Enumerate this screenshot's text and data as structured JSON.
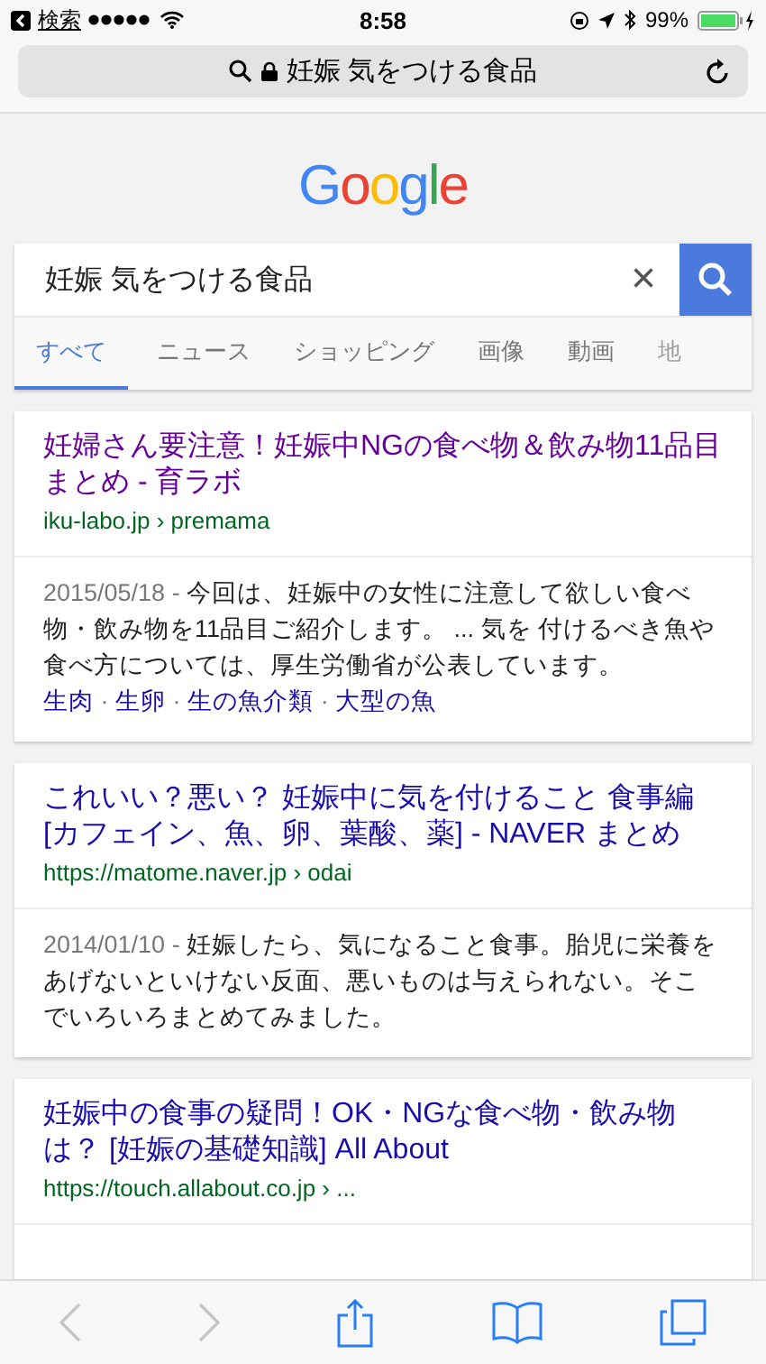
{
  "status_bar": {
    "back_label": "検索",
    "time": "8:58",
    "battery": "99%"
  },
  "address_bar": {
    "text": "妊娠 気をつける食品"
  },
  "logo": {
    "text": "Google"
  },
  "search": {
    "value": "妊娠 気をつける食品",
    "clear": "×"
  },
  "tabs": [
    {
      "label": "すべて",
      "selected": true
    },
    {
      "label": "ニュース",
      "selected": false
    },
    {
      "label": "ショッピング",
      "selected": false
    },
    {
      "label": "画像",
      "selected": false
    },
    {
      "label": "動画",
      "selected": false
    },
    {
      "label": "地",
      "selected": false
    }
  ],
  "results": [
    {
      "title": "妊婦さん要注意！妊娠中NGの食べ物＆飲み物11品目まとめ - 育ラボ",
      "visited": true,
      "url": "iku-labo.jp › premama",
      "date": "2015/05/18 - ",
      "snippet": "今回は、妊娠中の女性に注意して欲しい食べ物・飲み物を11品目ご紹介します。 ... 気を 付けるべき魚や食べ方については、厚生労働省が公表しています。",
      "links": [
        "生肉",
        "生卵",
        "生の魚介類",
        "大型の魚"
      ],
      "link_separator": "·"
    },
    {
      "title": "これいい？悪い？ 妊娠中に気を付けること 食事編 [カフェイン、魚、卵、葉酸、薬] - NAVER まとめ",
      "visited": false,
      "url": "https://matome.naver.jp › odai",
      "date": "2014/01/10 - ",
      "snippet": "妊娠したら、気になること食事。胎児に栄養をあげないといけない反面、悪いものは与えられない。そこでいろいろまとめてみました。"
    },
    {
      "title": "妊娠中の食事の疑問！OK・NGな食べ物・飲み物は？ [妊娠の基礎知識] All About",
      "visited": false,
      "url": "https://touch.allabout.co.jp › ..."
    }
  ],
  "toolbar": {
    "back_disabled": true,
    "forward_disabled": true
  }
}
